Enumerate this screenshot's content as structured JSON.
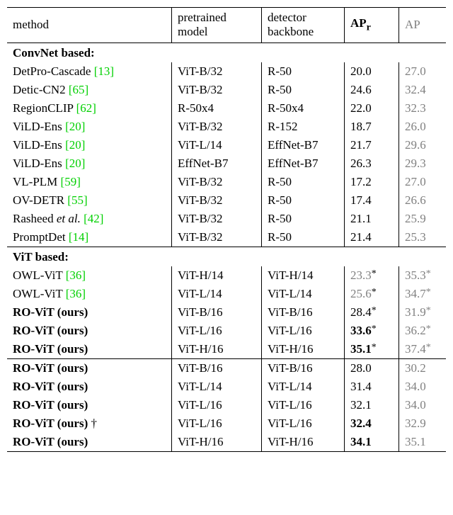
{
  "headers": {
    "method": "method",
    "pretrained": "pretrained model",
    "backbone": "detector backbone",
    "apr": "AP",
    "apr_sub": "r",
    "ap": "AP"
  },
  "sections": [
    {
      "title": "ConvNet based:"
    },
    {
      "title": "ViT based:"
    }
  ],
  "rows_conv": [
    {
      "method": "DetPro-Cascade",
      "cite": "[13]",
      "pre": "ViT-B/32",
      "bb": "R-50",
      "apr": "20.0",
      "ap": "27.0"
    },
    {
      "method": "Detic-CN2",
      "cite": "[65]",
      "pre": "ViT-B/32",
      "bb": "R-50",
      "apr": "24.6",
      "ap": "32.4"
    },
    {
      "method": "RegionCLIP",
      "cite": "[62]",
      "pre": "R-50x4",
      "bb": "R-50x4",
      "apr": "22.0",
      "ap": "32.3"
    },
    {
      "method": "ViLD-Ens",
      "cite": "[20]",
      "pre": "ViT-B/32",
      "bb": "R-152",
      "apr": "18.7",
      "ap": "26.0"
    },
    {
      "method": "ViLD-Ens",
      "cite": "[20]",
      "pre": "ViT-L/14",
      "bb": "EffNet-B7",
      "apr": "21.7",
      "ap": "29.6"
    },
    {
      "method": "ViLD-Ens",
      "cite": "[20]",
      "pre": "EffNet-B7",
      "bb": "EffNet-B7",
      "apr": "26.3",
      "ap": "29.3"
    },
    {
      "method": "VL-PLM",
      "cite": "[59]",
      "pre": "ViT-B/32",
      "bb": "R-50",
      "apr": "17.2",
      "ap": "27.0"
    },
    {
      "method": "OV-DETR",
      "cite": "[55]",
      "pre": "ViT-B/32",
      "bb": "R-50",
      "apr": "17.4",
      "ap": "26.6"
    },
    {
      "method_italic": "Rasheed <i>et al.</i>",
      "cite": "[42]",
      "pre": "ViT-B/32",
      "bb": "R-50",
      "apr": "21.1",
      "ap": "25.9"
    },
    {
      "method": "PromptDet",
      "cite": "[14]",
      "pre": "ViT-B/32",
      "bb": "R-50",
      "apr": "21.4",
      "ap": "25.3"
    }
  ],
  "rows_vit_a": [
    {
      "method": "OWL-ViT",
      "cite": "[36]",
      "pre": "ViT-H/14",
      "bb": "ViT-H/14",
      "apr": "23.3",
      "apr_grey": true,
      "apr_star": true,
      "ap": "35.3",
      "ap_star": true
    },
    {
      "method": "OWL-ViT",
      "cite": "[36]",
      "pre": "ViT-L/14",
      "bb": "ViT-L/14",
      "apr": "25.6",
      "apr_grey": true,
      "apr_star": true,
      "ap": "34.7",
      "ap_star": true
    },
    {
      "method_bold": "RO-ViT (ours)",
      "pre": "ViT-B/16",
      "bb": "ViT-B/16",
      "apr": "28.4",
      "apr_star": true,
      "ap": "31.9",
      "ap_star": true
    },
    {
      "method_bold": "RO-ViT (ours)",
      "pre": "ViT-L/16",
      "bb": "ViT-L/16",
      "apr": "33.6",
      "apr_bold": true,
      "apr_star": true,
      "ap": "36.2",
      "ap_star": true
    },
    {
      "method_bold": "RO-ViT (ours)",
      "pre": "ViT-H/16",
      "bb": "ViT-H/16",
      "apr": "35.1",
      "apr_bold": true,
      "apr_star": true,
      "ap": "37.4",
      "ap_star": true
    }
  ],
  "rows_vit_b": [
    {
      "method_bold": "RO-ViT (ours)",
      "pre": "ViT-B/16",
      "bb": "ViT-B/16",
      "apr": "28.0",
      "ap": "30.2"
    },
    {
      "method_bold": "RO-ViT (ours)",
      "pre": "ViT-L/14",
      "bb": "ViT-L/14",
      "apr": "31.4",
      "ap": "34.0"
    },
    {
      "method_bold": "RO-ViT (ours)",
      "pre": "ViT-L/16",
      "bb": "ViT-L/16",
      "apr": "32.1",
      "ap": "34.0"
    },
    {
      "method_bold": "RO-ViT (ours)",
      "dagger": true,
      "pre": "ViT-L/16",
      "bb": "ViT-L/16",
      "apr": "32.4",
      "apr_bold": true,
      "ap": "32.9"
    },
    {
      "method_bold": "RO-ViT (ours)",
      "pre": "ViT-H/16",
      "bb": "ViT-H/16",
      "apr": "34.1",
      "apr_bold": true,
      "ap": "35.1"
    }
  ]
}
